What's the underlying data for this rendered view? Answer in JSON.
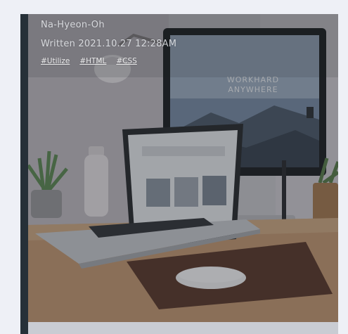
{
  "post": {
    "author": "Na-Hyeon-Oh",
    "written": "Written 2021.10.27 12:28AM",
    "tags": [
      "#Utilize",
      "#HTML",
      "#CSS"
    ]
  },
  "photo": {
    "screen_text": [
      "WORKHARD",
      "ANYWHERE"
    ]
  },
  "colors": {
    "page_bg": "#eef0f6",
    "card_dark": "#2b3038",
    "accent": "#263038",
    "meta_text": "#e8eaee"
  }
}
